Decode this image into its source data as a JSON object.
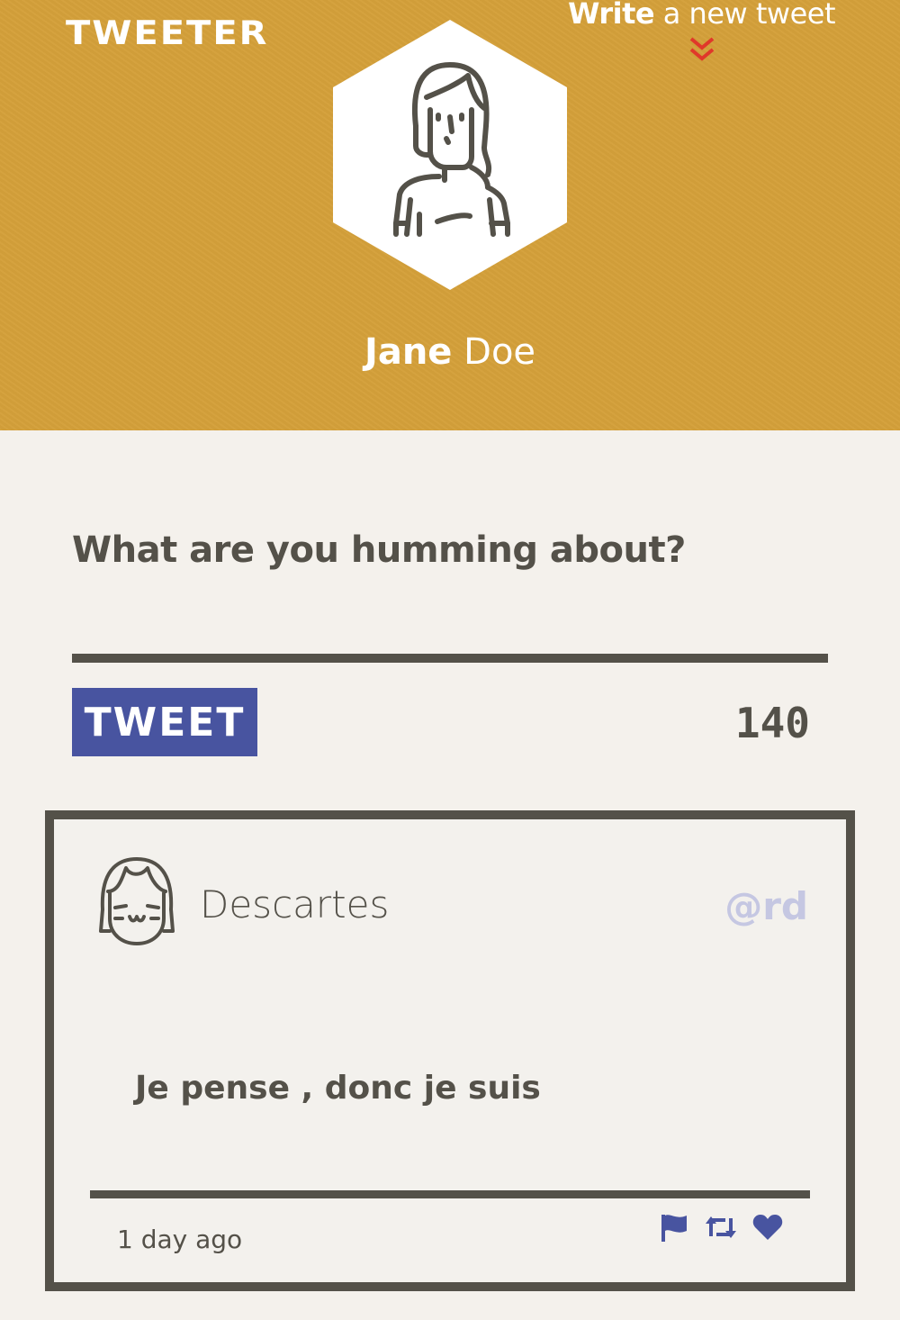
{
  "header": {
    "logo": "TWEETER",
    "compose_bold": "Write",
    "compose_rest": " a new tweet",
    "compose_icon": "double-chevron-down-icon",
    "avatar_icon": "woman-avatar-icon",
    "user_first": "Jane",
    "user_last": " Doe"
  },
  "composer": {
    "label": "What are you humming about?",
    "placeholder": "",
    "value": "",
    "button_label": "TWEET",
    "counter": "140"
  },
  "tweets": [
    {
      "avatar_icon": "smiling-face-avatar-icon",
      "author": "Descartes",
      "handle": "@rd",
      "body": "Je pense , donc je suis",
      "time": "1 day ago",
      "actions": [
        "flag-icon",
        "retweet-icon",
        "heart-icon"
      ]
    }
  ],
  "colors": {
    "header_bg": "#d4a03a",
    "page_bg": "#f4f1ec",
    "dark": "#545149",
    "accent": "#4854a0",
    "handle": "#c5c7e2",
    "chevron": "#e0382a"
  }
}
